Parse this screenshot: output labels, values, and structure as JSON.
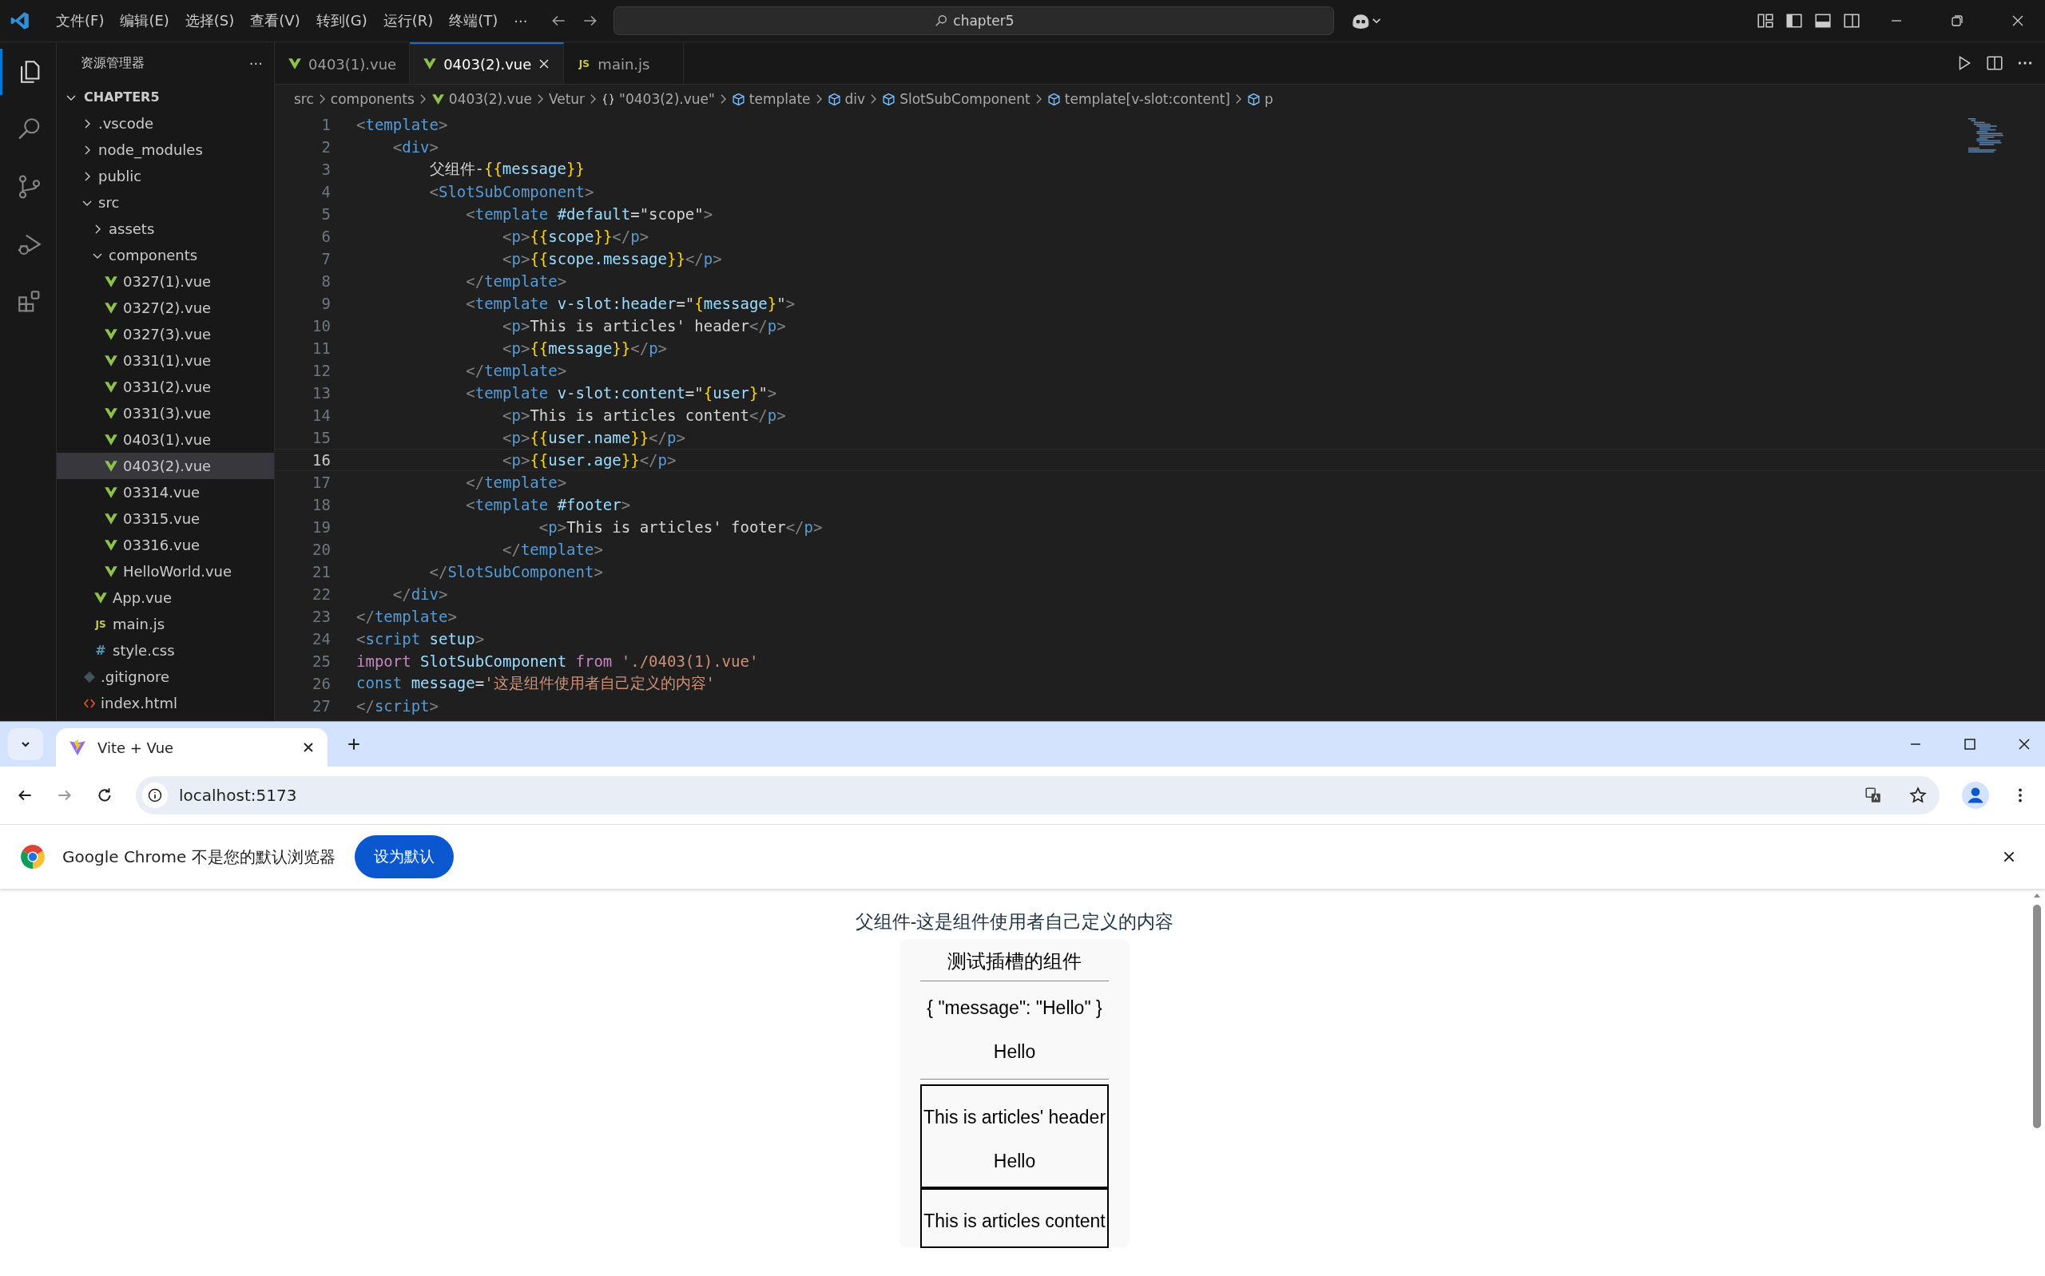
{
  "vscode": {
    "menu": [
      "文件(F)",
      "编辑(E)",
      "选择(S)",
      "查看(V)",
      "转到(G)",
      "运行(R)",
      "终端(T)"
    ],
    "menu_more": "···",
    "command_center": "chapter5",
    "activity_bar": [
      {
        "kind": "files",
        "selected": true
      },
      {
        "kind": "search",
        "selected": false
      },
      {
        "kind": "source-control",
        "selected": false
      },
      {
        "kind": "run-debug",
        "selected": false
      },
      {
        "kind": "extensions",
        "selected": false
      }
    ],
    "explorer": {
      "title": "资源管理器",
      "more": "···",
      "root": {
        "label": "CHAPTER5",
        "expanded": true,
        "children": [
          {
            "label": ".vscode",
            "kind": "folder",
            "expanded": false,
            "selected": false
          },
          {
            "label": "node_modules",
            "kind": "folder",
            "expanded": false,
            "selected": false
          },
          {
            "label": "public",
            "kind": "folder",
            "expanded": false,
            "selected": false
          },
          {
            "label": "src",
            "kind": "folder",
            "expanded": true,
            "selected": false,
            "children": [
              {
                "label": "assets",
                "kind": "folder",
                "expanded": false,
                "selected": false
              },
              {
                "label": "components",
                "kind": "folder",
                "expanded": true,
                "selected": false,
                "children": [
                  {
                    "label": "0327(1).vue",
                    "kind": "vue",
                    "selected": false
                  },
                  {
                    "label": "0327(2).vue",
                    "kind": "vue",
                    "selected": false
                  },
                  {
                    "label": "0327(3).vue",
                    "kind": "vue",
                    "selected": false
                  },
                  {
                    "label": "0331(1).vue",
                    "kind": "vue",
                    "selected": false
                  },
                  {
                    "label": "0331(2).vue",
                    "kind": "vue",
                    "selected": false
                  },
                  {
                    "label": "0331(3).vue",
                    "kind": "vue",
                    "selected": false
                  },
                  {
                    "label": "0403(1).vue",
                    "kind": "vue",
                    "selected": false
                  },
                  {
                    "label": "0403(2).vue",
                    "kind": "vue",
                    "selected": true
                  },
                  {
                    "label": "03314.vue",
                    "kind": "vue",
                    "selected": false
                  },
                  {
                    "label": "03315.vue",
                    "kind": "vue",
                    "selected": false
                  },
                  {
                    "label": "03316.vue",
                    "kind": "vue",
                    "selected": false
                  },
                  {
                    "label": "HelloWorld.vue",
                    "kind": "vue",
                    "selected": false
                  }
                ]
              },
              {
                "label": "App.vue",
                "kind": "vue",
                "selected": false
              },
              {
                "label": "main.js",
                "kind": "js",
                "badge": "JS",
                "selected": false
              },
              {
                "label": "style.css",
                "kind": "css",
                "badge": "#",
                "selected": false
              }
            ]
          },
          {
            "label": ".gitignore",
            "kind": "git",
            "selected": false
          },
          {
            "label": "index.html",
            "kind": "html",
            "selected": false
          }
        ]
      }
    },
    "tabs": [
      {
        "label": "0403(1).vue",
        "kind": "vue",
        "selected": false
      },
      {
        "label": "0403(2).vue",
        "kind": "vue",
        "selected": true
      },
      {
        "label": "main.js",
        "kind": "js",
        "badge": "JS",
        "selected": false
      }
    ],
    "breadcrumbs": [
      {
        "label": "src",
        "kind": "plain"
      },
      {
        "label": "components",
        "kind": "plain"
      },
      {
        "label": "0403(2).vue",
        "kind": "vue"
      },
      {
        "label": "Vetur",
        "kind": "plain"
      },
      {
        "label": "\"0403(2).vue\"",
        "kind": "braces"
      },
      {
        "label": "template",
        "kind": "element"
      },
      {
        "label": "div",
        "kind": "element"
      },
      {
        "label": "SlotSubComponent",
        "kind": "element"
      },
      {
        "label": "template[v-slot:content]",
        "kind": "element"
      },
      {
        "label": "p",
        "kind": "element"
      }
    ],
    "code": [
      {
        "n": "1",
        "current": false,
        "tokens": [
          {
            "kind": "punct",
            "t": "<"
          },
          {
            "kind": "tag",
            "t": "template"
          },
          {
            "kind": "punct",
            "t": ">"
          }
        ]
      },
      {
        "n": "2",
        "current": false,
        "tokens": [
          {
            "kind": "punct",
            "t": "    <"
          },
          {
            "kind": "tag",
            "t": "div"
          },
          {
            "kind": "punct",
            "t": ">"
          }
        ]
      },
      {
        "n": "3",
        "current": false,
        "tokens": [
          {
            "kind": "text",
            "t": "        父组件-"
          },
          {
            "kind": "brace",
            "t": "{{"
          },
          {
            "kind": "var",
            "t": "message"
          },
          {
            "kind": "brace",
            "t": "}}"
          }
        ]
      },
      {
        "n": "4",
        "current": false,
        "tokens": [
          {
            "kind": "punct",
            "t": "        <"
          },
          {
            "kind": "tag",
            "t": "SlotSubComponent"
          },
          {
            "kind": "punct",
            "t": ">"
          }
        ]
      },
      {
        "n": "5",
        "current": false,
        "tokens": [
          {
            "kind": "punct",
            "t": "            <"
          },
          {
            "kind": "tag",
            "t": "template"
          },
          {
            "kind": "attr",
            "t": " #default"
          },
          {
            "kind": "text",
            "t": "=\"scope\""
          },
          {
            "kind": "punct",
            "t": ">"
          }
        ]
      },
      {
        "n": "6",
        "current": false,
        "tokens": [
          {
            "kind": "punct",
            "t": "                <"
          },
          {
            "kind": "tag",
            "t": "p"
          },
          {
            "kind": "punct",
            "t": ">"
          },
          {
            "kind": "brace",
            "t": "{{"
          },
          {
            "kind": "var",
            "t": "scope"
          },
          {
            "kind": "brace",
            "t": "}}"
          },
          {
            "kind": "punct",
            "t": "</"
          },
          {
            "kind": "tag",
            "t": "p"
          },
          {
            "kind": "punct",
            "t": ">"
          }
        ]
      },
      {
        "n": "7",
        "current": false,
        "tokens": [
          {
            "kind": "punct",
            "t": "                <"
          },
          {
            "kind": "tag",
            "t": "p"
          },
          {
            "kind": "punct",
            "t": ">"
          },
          {
            "kind": "brace",
            "t": "{{"
          },
          {
            "kind": "var",
            "t": "scope.message"
          },
          {
            "kind": "brace",
            "t": "}}"
          },
          {
            "kind": "punct",
            "t": "</"
          },
          {
            "kind": "tag",
            "t": "p"
          },
          {
            "kind": "punct",
            "t": ">"
          }
        ]
      },
      {
        "n": "8",
        "current": false,
        "tokens": [
          {
            "kind": "punct",
            "t": "            </"
          },
          {
            "kind": "tag",
            "t": "template"
          },
          {
            "kind": "punct",
            "t": ">"
          }
        ]
      },
      {
        "n": "9",
        "current": false,
        "tokens": [
          {
            "kind": "punct",
            "t": "            <"
          },
          {
            "kind": "tag",
            "t": "template"
          },
          {
            "kind": "attr",
            "t": " v-slot:header"
          },
          {
            "kind": "text",
            "t": "=\""
          },
          {
            "kind": "brace",
            "t": "{"
          },
          {
            "kind": "var",
            "t": "message"
          },
          {
            "kind": "brace",
            "t": "}"
          },
          {
            "kind": "text",
            "t": "\""
          },
          {
            "kind": "punct",
            "t": ">"
          }
        ]
      },
      {
        "n": "10",
        "current": false,
        "tokens": [
          {
            "kind": "punct",
            "t": "                <"
          },
          {
            "kind": "tag",
            "t": "p"
          },
          {
            "kind": "punct",
            "t": ">"
          },
          {
            "kind": "text",
            "t": "This is articles' header"
          },
          {
            "kind": "punct",
            "t": "</"
          },
          {
            "kind": "tag",
            "t": "p"
          },
          {
            "kind": "punct",
            "t": ">"
          }
        ]
      },
      {
        "n": "11",
        "current": false,
        "tokens": [
          {
            "kind": "punct",
            "t": "                <"
          },
          {
            "kind": "tag",
            "t": "p"
          },
          {
            "kind": "punct",
            "t": ">"
          },
          {
            "kind": "brace",
            "t": "{{"
          },
          {
            "kind": "var",
            "t": "message"
          },
          {
            "kind": "brace",
            "t": "}}"
          },
          {
            "kind": "punct",
            "t": "</"
          },
          {
            "kind": "tag",
            "t": "p"
          },
          {
            "kind": "punct",
            "t": ">"
          }
        ]
      },
      {
        "n": "12",
        "current": false,
        "tokens": [
          {
            "kind": "punct",
            "t": "            </"
          },
          {
            "kind": "tag",
            "t": "template"
          },
          {
            "kind": "punct",
            "t": ">"
          }
        ]
      },
      {
        "n": "13",
        "current": false,
        "tokens": [
          {
            "kind": "punct",
            "t": "            <"
          },
          {
            "kind": "tag",
            "t": "template"
          },
          {
            "kind": "attr",
            "t": " v-slot:content"
          },
          {
            "kind": "text",
            "t": "=\""
          },
          {
            "kind": "brace",
            "t": "{"
          },
          {
            "kind": "var",
            "t": "user"
          },
          {
            "kind": "brace",
            "t": "}"
          },
          {
            "kind": "text",
            "t": "\""
          },
          {
            "kind": "punct",
            "t": ">"
          }
        ]
      },
      {
        "n": "14",
        "current": false,
        "tokens": [
          {
            "kind": "punct",
            "t": "                <"
          },
          {
            "kind": "tag",
            "t": "p"
          },
          {
            "kind": "punct",
            "t": ">"
          },
          {
            "kind": "text",
            "t": "This is articles content"
          },
          {
            "kind": "punct",
            "t": "</"
          },
          {
            "kind": "tag",
            "t": "p"
          },
          {
            "kind": "punct",
            "t": ">"
          }
        ]
      },
      {
        "n": "15",
        "current": false,
        "tokens": [
          {
            "kind": "punct",
            "t": "                <"
          },
          {
            "kind": "tag",
            "t": "p"
          },
          {
            "kind": "punct",
            "t": ">"
          },
          {
            "kind": "brace",
            "t": "{{"
          },
          {
            "kind": "var",
            "t": "user.name"
          },
          {
            "kind": "brace",
            "t": "}}"
          },
          {
            "kind": "punct",
            "t": "</"
          },
          {
            "kind": "tag",
            "t": "p"
          },
          {
            "kind": "punct",
            "t": ">"
          }
        ]
      },
      {
        "n": "16",
        "current": true,
        "tokens": [
          {
            "kind": "punct",
            "t": "                <"
          },
          {
            "kind": "tag",
            "t": "p"
          },
          {
            "kind": "punct",
            "t": ">"
          },
          {
            "kind": "brace",
            "t": "{{"
          },
          {
            "kind": "var",
            "t": "user.age"
          },
          {
            "kind": "brace",
            "t": "}}"
          },
          {
            "kind": "punct",
            "t": "</"
          },
          {
            "kind": "tag",
            "t": "p"
          },
          {
            "kind": "punct",
            "t": ">"
          }
        ]
      },
      {
        "n": "17",
        "current": false,
        "tokens": [
          {
            "kind": "punct",
            "t": "            </"
          },
          {
            "kind": "tag",
            "t": "template"
          },
          {
            "kind": "punct",
            "t": ">"
          }
        ]
      },
      {
        "n": "18",
        "current": false,
        "tokens": [
          {
            "kind": "punct",
            "t": "            <"
          },
          {
            "kind": "tag",
            "t": "template"
          },
          {
            "kind": "attr",
            "t": " #footer"
          },
          {
            "kind": "punct",
            "t": ">"
          }
        ]
      },
      {
        "n": "19",
        "current": false,
        "tokens": [
          {
            "kind": "punct",
            "t": "                    <"
          },
          {
            "kind": "tag",
            "t": "p"
          },
          {
            "kind": "punct",
            "t": ">"
          },
          {
            "kind": "text",
            "t": "This is articles' footer"
          },
          {
            "kind": "punct",
            "t": "</"
          },
          {
            "kind": "tag",
            "t": "p"
          },
          {
            "kind": "punct",
            "t": ">"
          }
        ]
      },
      {
        "n": "20",
        "current": false,
        "tokens": [
          {
            "kind": "punct",
            "t": "                </"
          },
          {
            "kind": "tag",
            "t": "template"
          },
          {
            "kind": "punct",
            "t": ">"
          }
        ]
      },
      {
        "n": "21",
        "current": false,
        "tokens": [
          {
            "kind": "punct",
            "t": "        </"
          },
          {
            "kind": "tag",
            "t": "SlotSubComponent"
          },
          {
            "kind": "punct",
            "t": ">"
          }
        ]
      },
      {
        "n": "22",
        "current": false,
        "tokens": [
          {
            "kind": "punct",
            "t": "    </"
          },
          {
            "kind": "tag",
            "t": "div"
          },
          {
            "kind": "punct",
            "t": ">"
          }
        ]
      },
      {
        "n": "23",
        "current": false,
        "tokens": [
          {
            "kind": "punct",
            "t": "</"
          },
          {
            "kind": "tag",
            "t": "template"
          },
          {
            "kind": "punct",
            "t": ">"
          }
        ]
      },
      {
        "n": "24",
        "current": false,
        "tokens": [
          {
            "kind": "punct",
            "t": "<"
          },
          {
            "kind": "tag",
            "t": "script"
          },
          {
            "kind": "attr",
            "t": " setup"
          },
          {
            "kind": "punct",
            "t": ">"
          }
        ]
      },
      {
        "n": "25",
        "current": false,
        "tokens": [
          {
            "kind": "keyword",
            "t": "import"
          },
          {
            "kind": "var",
            "t": " SlotSubComponent"
          },
          {
            "kind": "keyword",
            "t": " from"
          },
          {
            "kind": "str",
            "t": " './0403(1).vue'"
          }
        ]
      },
      {
        "n": "26",
        "current": false,
        "tokens": [
          {
            "kind": "decl",
            "t": "const"
          },
          {
            "kind": "var",
            "t": " message"
          },
          {
            "kind": "text",
            "t": "="
          },
          {
            "kind": "str",
            "t": "'这是组件使用者自己定义的内容'"
          }
        ]
      },
      {
        "n": "27",
        "current": false,
        "tokens": [
          {
            "kind": "punct",
            "t": "</"
          },
          {
            "kind": "tag",
            "t": "script"
          },
          {
            "kind": "punct",
            "t": ">"
          }
        ]
      }
    ]
  },
  "browser": {
    "tab": {
      "title": "Vite + Vue"
    },
    "url": "localhost:5173",
    "infobar": {
      "text": "Google Chrome 不是您的默认浏览器",
      "button": "设为默认"
    },
    "page": {
      "heading": "父组件-这是组件使用者自己定义的内容",
      "card": {
        "title": "测试插槽的组件",
        "scope": "{ \"message\": \"Hello\" }",
        "scope_message": "Hello",
        "header_slot": [
          "This is articles' header",
          "Hello"
        ],
        "content_slot": [
          "This is articles content"
        ]
      }
    }
  }
}
